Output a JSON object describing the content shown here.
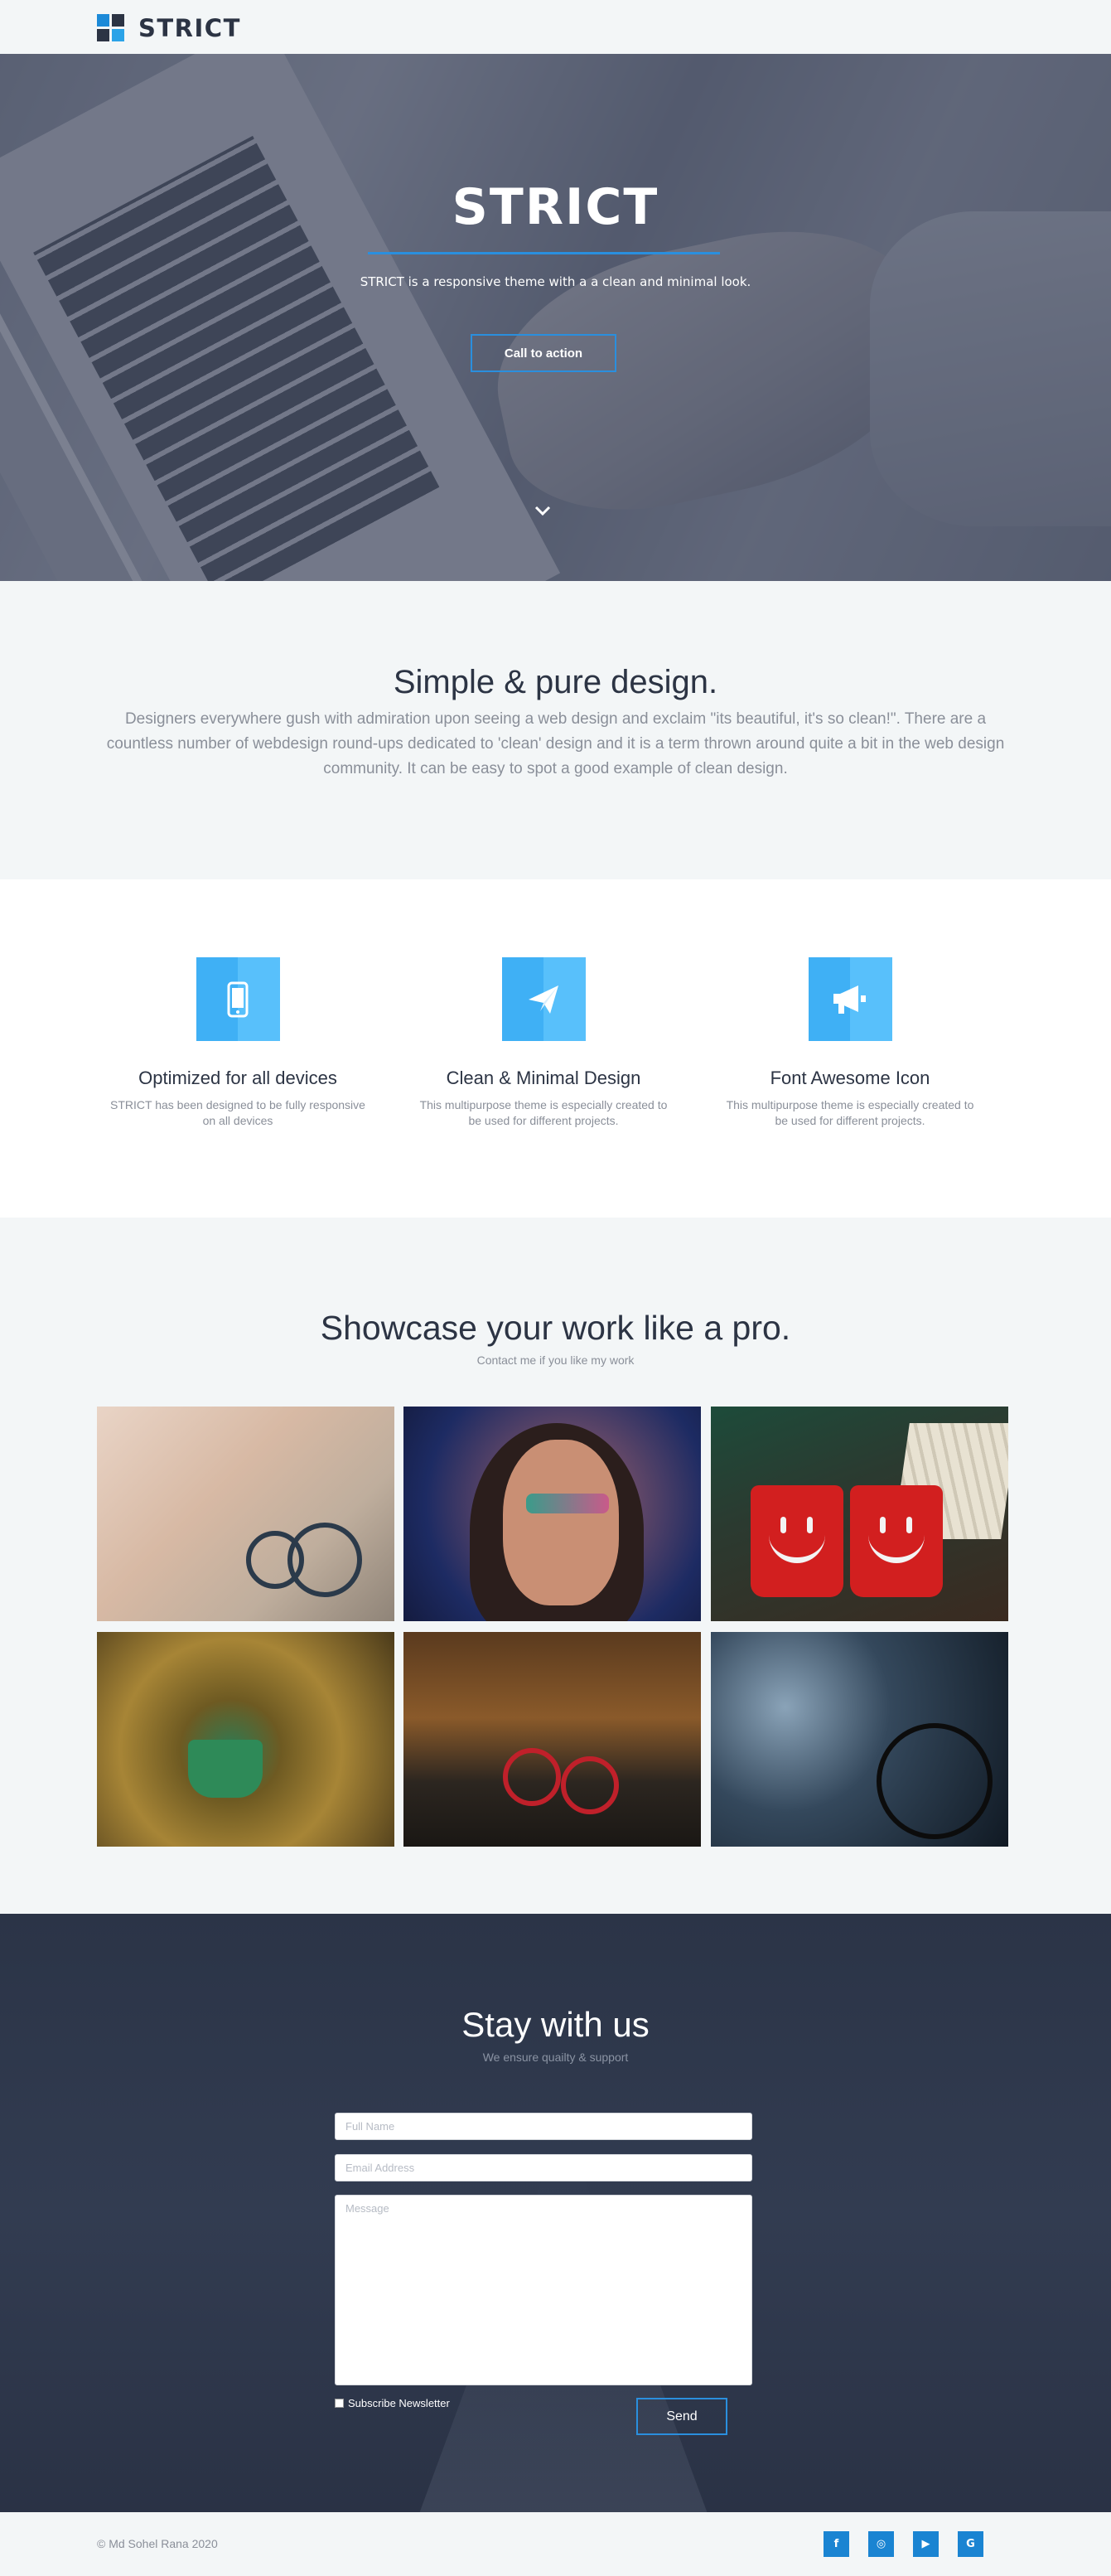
{
  "nav": {
    "brand": "STRICT"
  },
  "hero": {
    "title": "STRICT",
    "subtitle": "STRICT is a responsive theme with a a clean and minimal look.",
    "cta_label": "Call to action",
    "scroll_icon": "chevron-down-icon"
  },
  "intro": {
    "heading": "Simple & pure design.",
    "body": "Designers everywhere gush with admiration upon seeing a web design and exclaim \"its beautiful, it's so clean!\". There are a countless number of webdesign round-ups dedicated to 'clean' design and it is a term thrown around quite a bit in the web design community. It can be easy to spot a good example of clean design."
  },
  "features": [
    {
      "icon": "mobile-icon",
      "title": "Optimized for all devices",
      "text": "STRICT has been designed to be fully responsive on all devices"
    },
    {
      "icon": "paper-plane-icon",
      "title": "Clean & Minimal Design",
      "text": "This multipurpose theme is especially created to be used for different projects."
    },
    {
      "icon": "bullhorn-icon",
      "title": "Font Awesome Icon",
      "text": "This multipurpose theme is especially created to be used for different projects."
    }
  ],
  "showcase": {
    "heading": "Showcase your work like a pro.",
    "subtitle": "Contact me if you like my work"
  },
  "contact": {
    "heading": "Stay with us",
    "subtitle": "We ensure quailty & support",
    "name_placeholder": "Full Name",
    "email_placeholder": "Email Address",
    "message_placeholder": "Message",
    "newsletter_label": "Subscribe Newsletter",
    "send_label": "Send"
  },
  "footer": {
    "copyright": "© Md Sohel Rana 2020",
    "socials": [
      {
        "icon": "facebook-icon",
        "glyph": "f"
      },
      {
        "icon": "instagram-icon",
        "glyph": "◎"
      },
      {
        "icon": "youtube-icon",
        "glyph": "▶"
      },
      {
        "icon": "google-icon",
        "glyph": "G"
      }
    ]
  },
  "colors": {
    "accent": "#2a8fde",
    "dark": "#2c3444",
    "light_bg": "#f3f6f7",
    "icon_blue": "#3fb0f5"
  }
}
